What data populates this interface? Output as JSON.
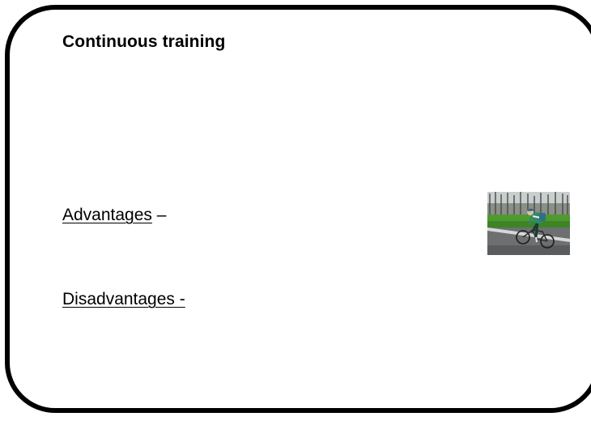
{
  "slide": {
    "title": "Continuous training",
    "advantages": {
      "label": "Advantages",
      "separator": " –"
    },
    "disadvantages": {
      "label": "Disadvantages -"
    }
  },
  "image": {
    "icon": "cyclist-photo"
  },
  "colors": {
    "border": "#000000",
    "text": "#000000",
    "background": "#ffffff"
  }
}
